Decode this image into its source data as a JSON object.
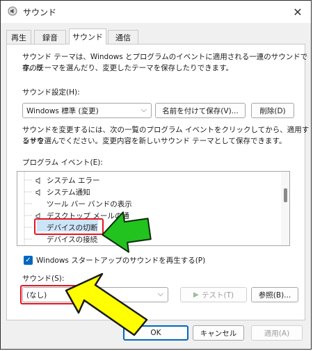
{
  "window": {
    "title": "サウンド",
    "close": "✕"
  },
  "tabs": [
    {
      "label": "再生"
    },
    {
      "label": "録音"
    },
    {
      "label": "サウンド"
    },
    {
      "label": "通信"
    }
  ],
  "sound_panel": {
    "intro_line1": "サウンド テーマは、Windows とプログラムのイベントに適用される一連のサウンドです。既",
    "intro_line2": "存のテーマを選んだり、変更したテーマを保存したりできます。",
    "scheme_label": "サウンド設定(H):",
    "scheme_value": "Windows 標準 (変更)",
    "save_as_button": "名前を付けて保存(V)...",
    "delete_button": "削除(D)",
    "help_line1": "サウンドを変更するには、次の一覧のプログラム イベントをクリックしてから、適用するサウ",
    "help_line2": "ンドを選んでください。変更内容を新しいサウンド テーマとして保存できます。",
    "events_label": "プログラム イベント(E):",
    "events": [
      {
        "label": "システム エラー",
        "has_sound": true
      },
      {
        "label": "システム通知",
        "has_sound": true
      },
      {
        "label": "ツール バー バンドの表示",
        "has_sound": false
      },
      {
        "label": "デスクトップ メールの通",
        "has_sound": true
      },
      {
        "label": "デバイスの切断",
        "has_sound": false,
        "selected": true
      },
      {
        "label": "デバイスの接続",
        "has_sound": false
      }
    ],
    "startup_checkbox_label": "Windows スタートアップのサウンドを再生する(P)",
    "startup_checked": true,
    "sounds_label": "サウンド(S):",
    "sound_value": "(なし)",
    "test_button": "テスト(T)",
    "browse_button": "参照(B)..."
  },
  "footer": {
    "ok": "OK",
    "cancel": "キャンセル",
    "apply": "適用(A)"
  },
  "colors": {
    "annotation_red": "#e8141e",
    "green_arrow": "#22c21f",
    "yellow_arrow": "#ffff00",
    "checkbox_accent": "#0067c0"
  }
}
